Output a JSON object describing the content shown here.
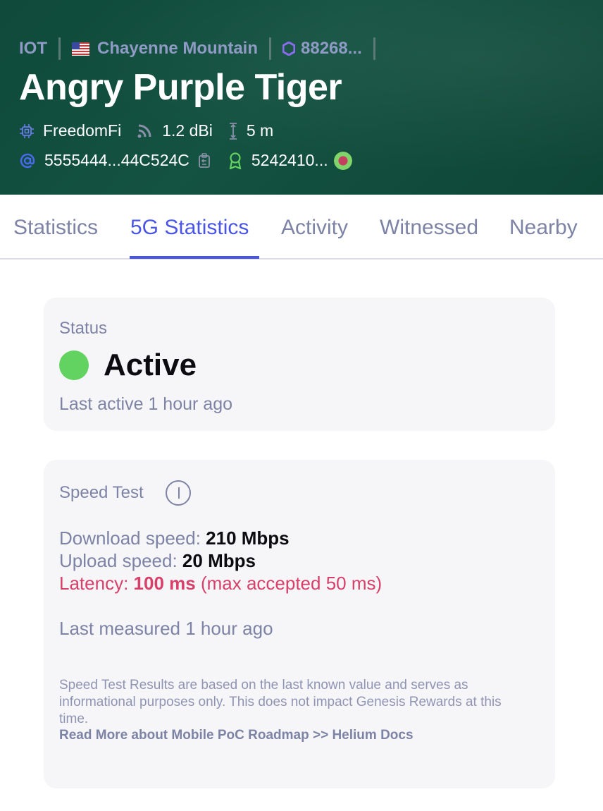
{
  "header": {
    "network": "IOT",
    "location": "Chayenne Mountain",
    "hex_id": "88268...",
    "title": "Angry Purple Tiger",
    "maker": "FreedomFi",
    "gain": "1.2 dBi",
    "elevation": "5 m",
    "owner_address": "5555444...44C524C",
    "reward_id": "5242410...",
    "colors": {
      "background": "#145241",
      "crumb_text": "#8f9bc4",
      "icon_blue": "#4a55e6",
      "icon_purple": "#8b6cf0",
      "icon_green": "#62d260"
    }
  },
  "tabs": {
    "items": [
      "Statistics",
      "5G Statistics",
      "Activity",
      "Witnessed",
      "Nearby"
    ],
    "active": "5G Statistics"
  },
  "status_card": {
    "label": "Status",
    "state": "Active",
    "last_active": "Last active 1 hour ago",
    "dot_color": "#62d260"
  },
  "speed_card": {
    "label": "Speed Test",
    "download_label": "Download speed:",
    "download_value": "210 Mbps",
    "upload_label": "Upload speed:",
    "upload_value": "20 Mbps",
    "latency_label": "Latency:",
    "latency_value": "100 ms",
    "latency_note": "(max accepted 50 ms)",
    "last_measured": "Last measured 1 hour ago",
    "disclaimer": "Speed Test Results are based on the last known value and serves as informational purposes only. This does not impact Genesis Rewards at this time.",
    "doc_link": "Read More about Mobile PoC Roadmap >> Helium Docs",
    "warn_color": "#d8406a"
  }
}
